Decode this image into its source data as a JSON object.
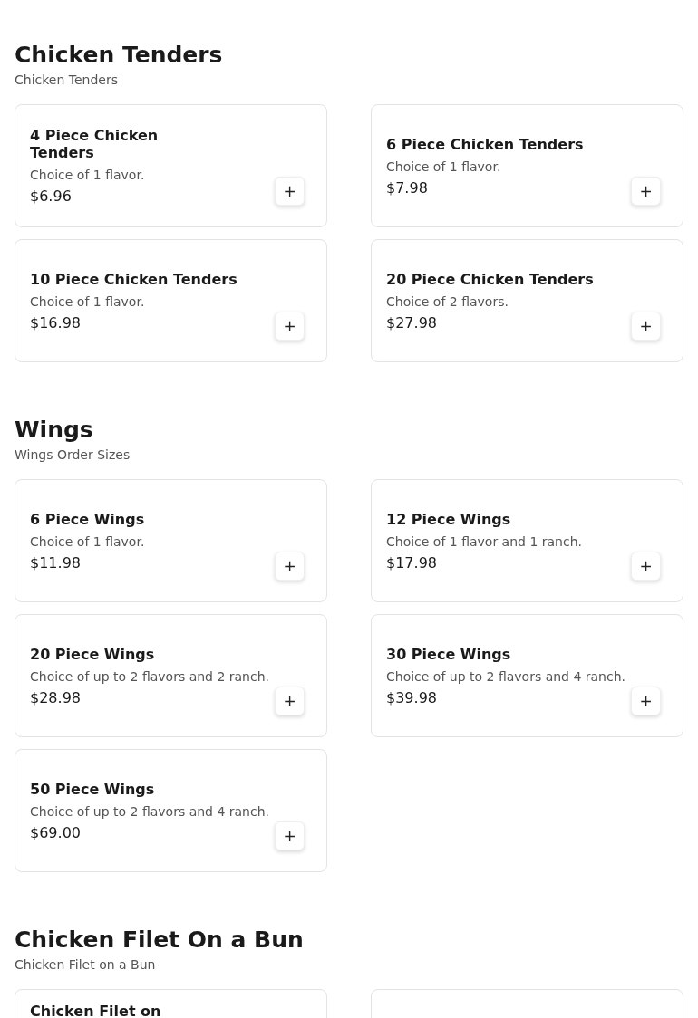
{
  "sections": [
    {
      "title": "Chicken Tenders",
      "subtitle": "Chicken Tenders",
      "items": [
        {
          "name": "4 Piece Chicken\nTenders",
          "description": "Choice of 1 flavor.",
          "price": "$6.96",
          "add": "+"
        },
        {
          "name": "6 Piece Chicken Tenders",
          "description": "Choice of 1 flavor.",
          "price": "$7.98",
          "add": "+"
        },
        {
          "name": "10 Piece Chicken Tenders",
          "description": "Choice of 1 flavor.",
          "price": "$16.98",
          "add": "+"
        },
        {
          "name": "20 Piece Chicken Tenders",
          "description": "Choice of 2 flavors.",
          "price": "$27.98",
          "add": "+"
        }
      ]
    },
    {
      "title": "Wings",
      "subtitle": "Wings Order Sizes",
      "items": [
        {
          "name": "6 Piece Wings",
          "description": "Choice of 1 flavor.",
          "price": "$11.98",
          "add": "+"
        },
        {
          "name": "12 Piece Wings",
          "description": "Choice of 1 flavor and 1 ranch.",
          "price": "$17.98",
          "add": "+"
        },
        {
          "name": "20 Piece Wings",
          "description": "Choice of up to 2 flavors and 2 ranch.",
          "price": "$28.98",
          "add": "+"
        },
        {
          "name": "30 Piece Wings",
          "description": "Choice of up to 2 flavors and 4 ranch.",
          "price": "$39.98",
          "add": "+"
        },
        {
          "name": "50 Piece Wings",
          "description": "Choice of up to 2 flavors and 4 ranch.",
          "price": "$69.00",
          "add": "+"
        }
      ]
    },
    {
      "title": "Chicken Filet On a Bun",
      "subtitle": "Chicken Filet on a Bun",
      "items": [
        {
          "kind": "partial",
          "name": "Chicken Filet on"
        },
        {
          "kind": "partial"
        }
      ]
    }
  ]
}
